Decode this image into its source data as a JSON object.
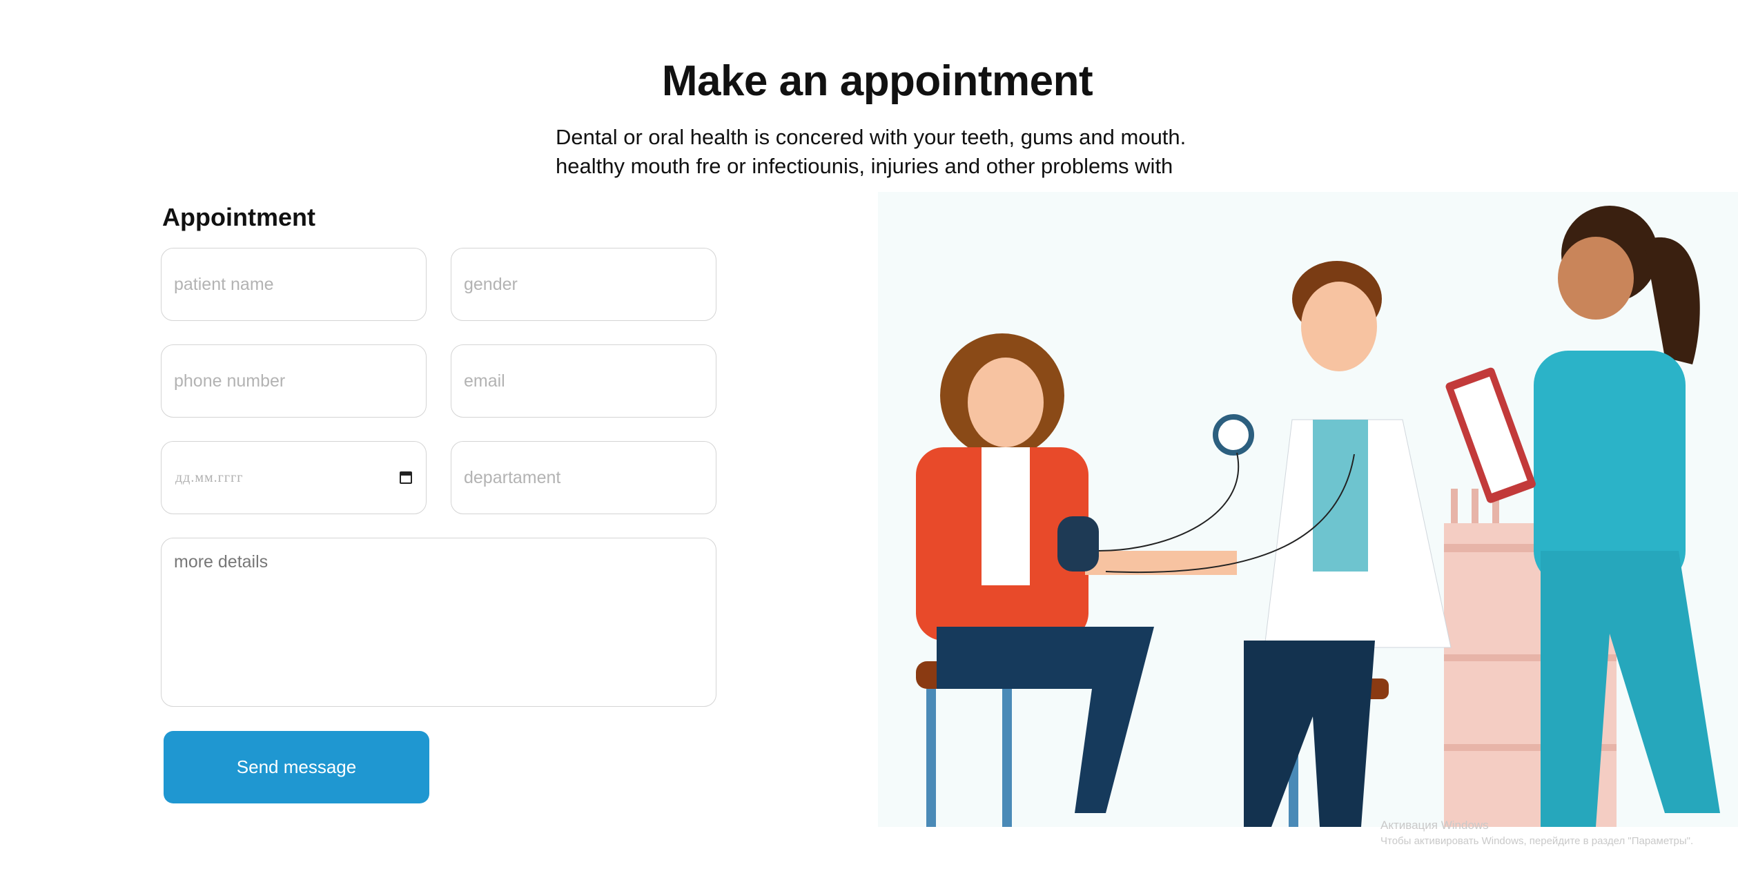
{
  "page": {
    "title": "Make an appointment",
    "description_line1": "Dental or oral health is concered with your teeth, gums and mouth.",
    "description_line2": "healthy mouth fre or infectiounis, injuries and other problems with"
  },
  "form": {
    "heading": "Appointment",
    "patient_name_placeholder": "patient name",
    "gender_placeholder": "gender",
    "phone_placeholder": "phone number",
    "email_placeholder": "email",
    "date_placeholder": "дд.мм.гггг",
    "department_placeholder": "departament",
    "details_placeholder": "more details",
    "submit_label": "Send message"
  },
  "icons": {
    "date_picker": "calendar-icon"
  },
  "colors": {
    "accent": "#1f97d1",
    "nurse_uniform": "#2bb3c8",
    "patient_jacket": "#e84a2a"
  },
  "os_watermark": {
    "line1": "Активация Windows",
    "line2": "Чтобы активировать Windows, перейдите в раздел \"Параметры\"."
  }
}
